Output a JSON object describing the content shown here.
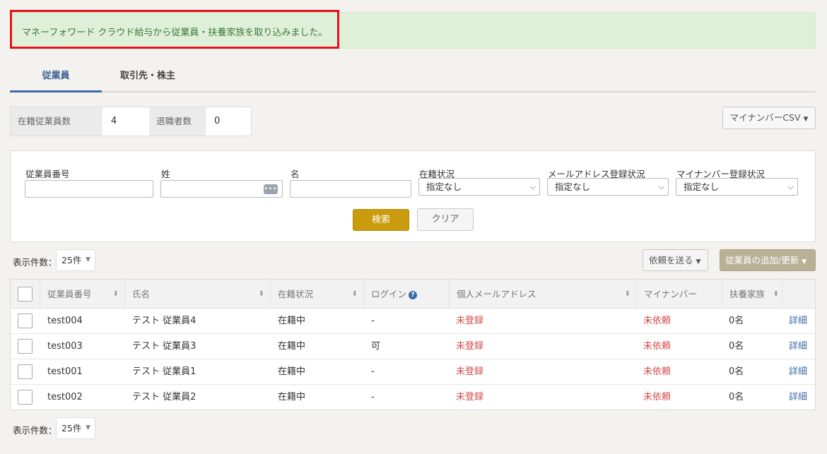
{
  "alert": {
    "message": "マネーフォワード クラウド給与から従業員・扶養家族を取り込みました。"
  },
  "tabs": [
    {
      "label": "従業員",
      "active": true
    },
    {
      "label": "取引先・株主",
      "active": false
    }
  ],
  "counts": {
    "active_label": "在籍従業員数",
    "active_value": "4",
    "retired_label": "退職者数",
    "retired_value": "0"
  },
  "csv_button": "マイナンバーCSV",
  "search": {
    "employee_no_label": "従業員番号",
    "last_name_label": "姓",
    "first_name_label": "名",
    "status_label": "在籍状況",
    "status_value": "指定なし",
    "email_status_label": "メールアドレス登録状況",
    "email_status_value": "指定なし",
    "mynumber_status_label": "マイナンバー登録状況",
    "mynumber_status_value": "指定なし",
    "search_button": "検索",
    "clear_button": "クリア"
  },
  "per_page": {
    "label": "表示件数：",
    "value": "25件"
  },
  "actions": {
    "request_button": "依頼を送る",
    "add_button": "従業員の追加/更新"
  },
  "table": {
    "headers": {
      "employee_no": "従業員番号",
      "name": "氏名",
      "status": "在籍状況",
      "login": "ログイン",
      "email": "個人メールアドレス",
      "mynumber": "マイナンバー",
      "dependents": "扶養家族"
    },
    "rows": [
      {
        "employee_no": "test004",
        "name": "テスト 従業員4",
        "status": "在籍中",
        "login": "-",
        "email": "未登録",
        "mynumber": "未依頼",
        "dependents": "0名",
        "detail": "詳細"
      },
      {
        "employee_no": "test003",
        "name": "テスト 従業員3",
        "status": "在籍中",
        "login": "可",
        "email": "未登録",
        "mynumber": "未依頼",
        "dependents": "0名",
        "detail": "詳細"
      },
      {
        "employee_no": "test001",
        "name": "テスト 従業員1",
        "status": "在籍中",
        "login": "-",
        "email": "未登録",
        "mynumber": "未依頼",
        "dependents": "0名",
        "detail": "詳細"
      },
      {
        "employee_no": "test002",
        "name": "テスト 従業員2",
        "status": "在籍中",
        "login": "-",
        "email": "未登録",
        "mynumber": "未依頼",
        "dependents": "0名",
        "detail": "詳細"
      }
    ]
  },
  "colors": {
    "alert_bg": "#dff0d8",
    "highlight": "#e8101b",
    "accent": "#3d6aa8",
    "search_button": "#c99b0d",
    "status_red": "#d24b4b"
  }
}
